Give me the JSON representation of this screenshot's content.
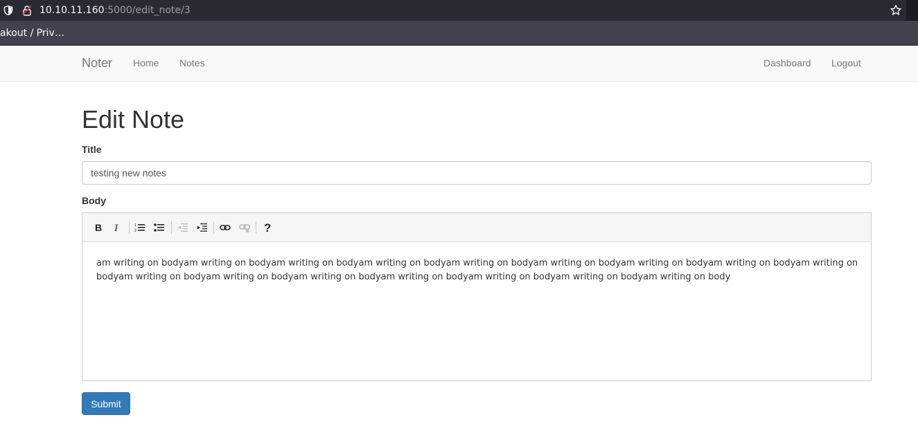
{
  "browser": {
    "url_host": "10.10.11.160",
    "url_path": ":5000/edit_note/3",
    "bookmark": "akout / Priv…"
  },
  "navbar": {
    "brand": "Noter",
    "left_links": [
      "Home",
      "Notes"
    ],
    "right_links": [
      "Dashboard",
      "Logout"
    ]
  },
  "form": {
    "heading": "Edit Note",
    "title_label": "Title",
    "title_value": "testing new notes",
    "body_label": "Body",
    "body_text": "am writing on bodyam writing on bodyam writing on bodyam writing on bodyam writing on bodyam writing on bodyam writing on bodyam writing on bodyam writing on bodyam writing on bodyam writing on bodyam writing on bodyam writing on bodyam writing on bodyam writing on bodyam writing on body",
    "submit_label": "Submit"
  },
  "toolbar": {
    "buttons": [
      "bold",
      "italic",
      "ordered-list",
      "unordered-list",
      "outdent",
      "indent",
      "link",
      "unlink",
      "help"
    ]
  },
  "colors": {
    "primary": "#337ab7",
    "navbar_bg": "#f8f8f8",
    "chrome_bg": "#2b2a33"
  }
}
